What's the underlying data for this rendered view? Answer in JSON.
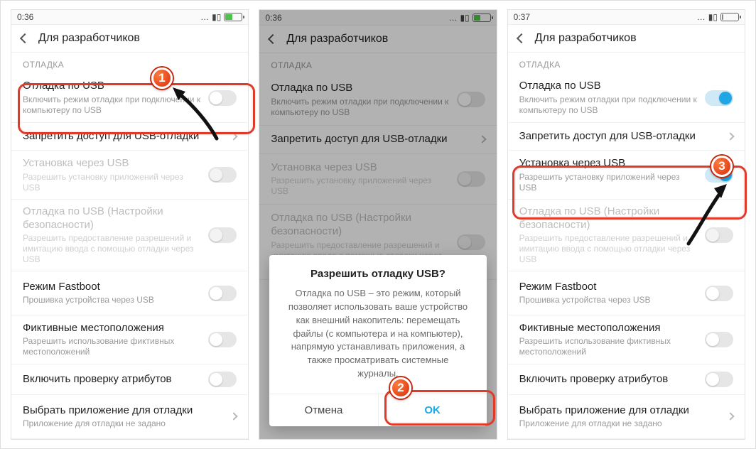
{
  "badges": {
    "one": "1",
    "two": "2",
    "three": "3"
  },
  "status": {
    "time_a": "0:36",
    "time_b": "0:36",
    "time_c": "0:37",
    "dots": "…"
  },
  "titlebar": {
    "title": "Для разработчиков"
  },
  "section": {
    "debug": "ОТЛАДКА"
  },
  "rows": {
    "usb_debug": {
      "title": "Отладка по USB",
      "desc": "Включить режим отладки при подключении к компьютеру по USB"
    },
    "revoke": {
      "title": "Запретить доступ для USB-отладки"
    },
    "install": {
      "title": "Установка через USB",
      "desc": "Разрешить установку приложений через USB"
    },
    "usb_sec": {
      "title": "Отладка по USB (Настройки безопасности)",
      "desc": "Разрешить предоставление разрешений и имитацию ввода с помощью отладки через USB"
    },
    "fastboot": {
      "title": "Режим Fastboot",
      "desc": "Прошивка устройства через USB"
    },
    "mock": {
      "title": "Фиктивные местоположения",
      "desc": "Разрешить использование фиктивных местоположений"
    },
    "attr": {
      "title": "Включить проверку атрибутов"
    },
    "pickapp": {
      "title": "Выбрать приложение для отладки",
      "desc": "Приложение для отладки не задано"
    }
  },
  "dialog": {
    "title": "Разрешить отладку USB?",
    "body": "Отладка по USB – это режим, который позволяет использовать ваше устройство как внешний накопитель: перемещать файлы (с компьютера и на компьютер), напрямую устанавливать приложения, а также просматривать системные журналы.",
    "cancel": "Отмена",
    "ok": "OK"
  },
  "colors": {
    "accent": "#1ea7e4",
    "hl": "#e03a2a",
    "battery_green": "#4cc24a"
  }
}
